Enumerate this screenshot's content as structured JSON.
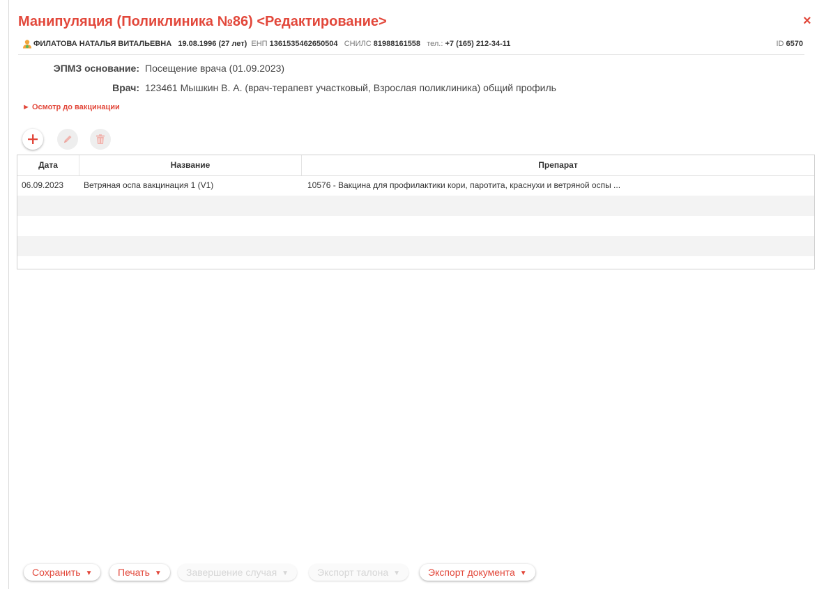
{
  "window": {
    "title": "Манипуляция (Поликлиника №86) <Редактирование>",
    "close_glyph": "×"
  },
  "patient": {
    "name": "ФИЛАТОВА НАТАЛЬЯ ВИТАЛЬЕВНА",
    "birth": "19.08.1996 (27 лет)",
    "enp_label": "ЕНП",
    "enp": "1361535462650504",
    "snils_label": "СНИЛС",
    "snils": "81988161558",
    "phone_label": "тел.:",
    "phone": "+7 (165) 212-34-11",
    "id_label": "ID",
    "id": "6570"
  },
  "info": {
    "epmz_label": "ЭПМЗ основание:",
    "epmz_value": "Посещение врача (01.09.2023)",
    "doctor_label": "Врач:",
    "doctor_value": "123461 Мышкин В. А. (врач-терапевт участковый, Взрослая поликлиника) общий профиль"
  },
  "expander": {
    "arrow": "►",
    "label": "Осмотр до вакцинации"
  },
  "toolbar": {
    "add_icon": "plus-icon",
    "edit_icon": "pencil-icon",
    "delete_icon": "trash-icon"
  },
  "table": {
    "columns": [
      "Дата",
      "Название",
      "Препарат"
    ],
    "rows": [
      {
        "date": "06.09.2023",
        "name": "Ветряная оспа вакцинация 1 (V1)",
        "drug": "10576 - Вакцина для профилактики кори, паротита, краснухи и ветряной оспы ..."
      }
    ]
  },
  "footer": {
    "save": "Сохранить",
    "print": "Печать",
    "finish_case": "Завершение случая",
    "export_ticket": "Экспорт талона",
    "export_doc": "Экспорт документа",
    "caret": "▼"
  },
  "colors": {
    "accent": "#e2473a",
    "avatar": "#f3a43b",
    "avatar_badge": "#5cb85c",
    "disabled": "#d6d6d6"
  }
}
